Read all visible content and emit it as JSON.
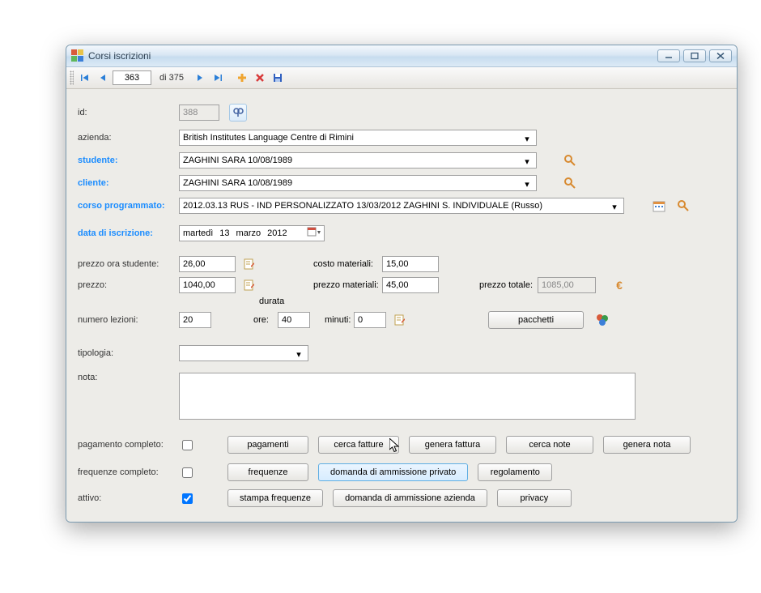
{
  "window": {
    "title": "Corsi iscrizioni"
  },
  "nav": {
    "current": "363",
    "total_text": "di 375"
  },
  "labels": {
    "id": "id:",
    "azienda": "azienda:",
    "studente": "studente:",
    "cliente": "cliente:",
    "corso": "corso programmato:",
    "data_iscrizione": "data di iscrizione:",
    "prezzo_ora": "prezzo ora studente:",
    "prezzo": "prezzo:",
    "costo_mat": "costo materiali:",
    "prezzo_mat": "prezzo materiali:",
    "prezzo_tot": "prezzo totale:",
    "numero_lezioni": "numero lezioni:",
    "durata": "durata",
    "ore": "ore:",
    "minuti": "minuti:",
    "tipologia": "tipologia:",
    "nota": "nota:",
    "pagamento_completo": "pagamento completo:",
    "frequenze_completo": "frequenze completo:",
    "attivo": "attivo:"
  },
  "values": {
    "id": "388",
    "azienda": "British Institutes Language Centre di Rimini",
    "studente": "ZAGHINI SARA 10/08/1989",
    "cliente": "ZAGHINI SARA 10/08/1989",
    "corso": "2012.03.13 RUS - IND PERSONALIZZATO 13/03/2012 ZAGHINI S. INDIVIDUALE (Russo)",
    "date_day_name": "martedì",
    "date_day": "13",
    "date_month": "marzo",
    "date_year": "2012",
    "prezzo_ora": "26,00",
    "prezzo": "1040,00",
    "costo_mat": "15,00",
    "prezzo_mat": "45,00",
    "prezzo_tot": "1085,00",
    "numero_lezioni": "20",
    "ore": "40",
    "minuti": "0",
    "tipologia": "",
    "nota": ""
  },
  "buttons": {
    "pacchetti": "pacchetti",
    "pagamenti": "pagamenti",
    "cerca_fatture": "cerca fatture",
    "genera_fattura": "genera fattura",
    "cerca_note": "cerca note",
    "genera_nota": "genera nota",
    "frequenze": "frequenze",
    "dom_priv": "domanda di ammissione privato",
    "regolamento": "regolamento",
    "stampa_freq": "stampa frequenze",
    "dom_az": "domanda di ammissione azienda",
    "privacy": "privacy"
  }
}
